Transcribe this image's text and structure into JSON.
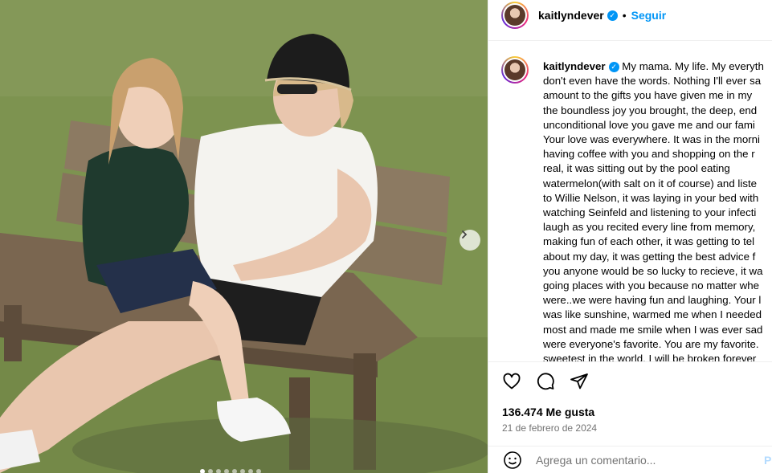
{
  "post": {
    "username": "kaitlyndever",
    "follow_label": "Seguir",
    "separator": "•",
    "caption_username": "kaitlyndever",
    "caption_body": " My mama. My life. My everyth\ndon't even have the words. Nothing I'll ever sa\namount to the gifts you have given me in my\nthe boundless joy you brought, the deep, end\nunconditional love you gave me and our fami\nYour love was everywhere. It was in the morni\nhaving coffee with you and shopping on the r\nreal, it was sitting out by the pool eating\nwatermelon(with salt on it of course) and liste\nto Willie Nelson, it was laying in your bed with\nwatching Seinfeld and listening to your infecti\nlaugh as you recited every line from memory,\nmaking fun of each other, it was getting to tel\nabout my day, it was getting the best advice f\nyou anyone would be so lucky to recieve, it wa\ngoing places with you because no matter whe\nwere..we were having fun and laughing. Your l\nwas like sunshine, warmed me when I needed\nmost and made me smile when I was ever sad\nwere everyone's favorite. You are my favorite.\nsweetest in the world. I will be broken forever",
    "likes": "136.474 Me gusta",
    "date": "21 de febrero de 2024",
    "comment_placeholder": "Agrega un comentario...",
    "publish_label": "P"
  },
  "carousel": {
    "slide_count": 8,
    "active_index": 0
  },
  "icons": {
    "verified": "verified-badge-icon",
    "like": "heart-icon",
    "comment": "comment-bubble-icon",
    "share": "send-paper-plane-icon",
    "emoji": "smiley-icon",
    "next": "chevron-right-icon"
  },
  "colors": {
    "accent": "#0095f6",
    "muted": "#737373",
    "divider": "#efefef"
  }
}
